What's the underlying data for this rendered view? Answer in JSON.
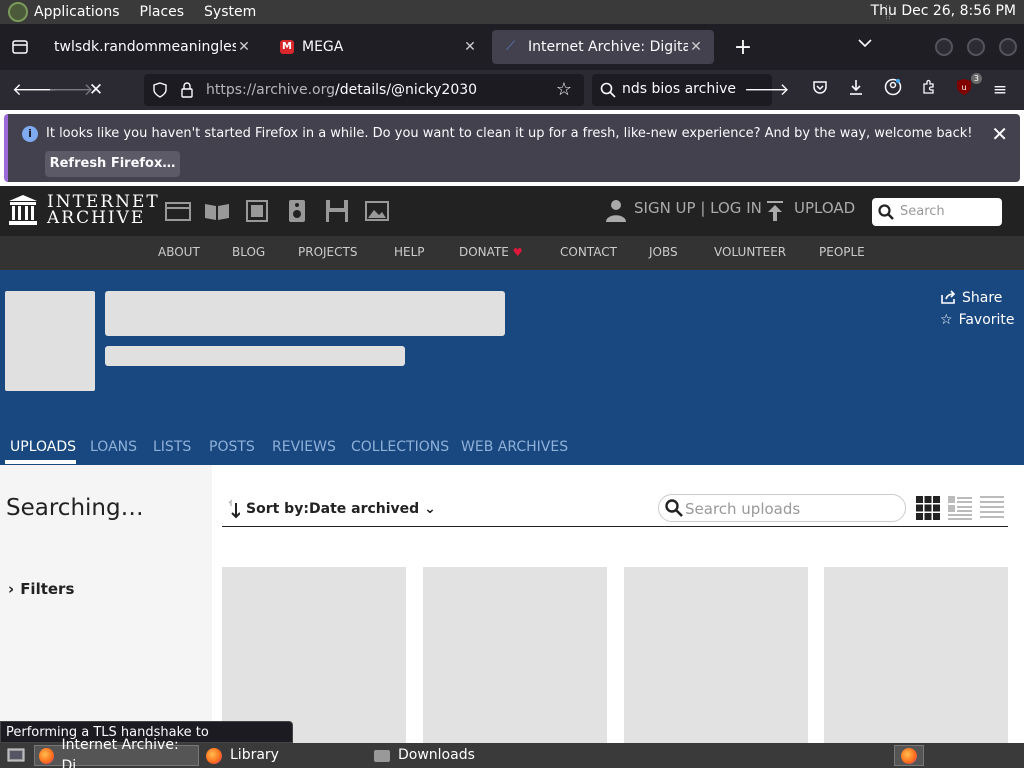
{
  "system_panel": {
    "menus": [
      "Applications",
      "Places",
      "System"
    ],
    "clock": "Thu Dec 26,  8:56 PM"
  },
  "tabs": [
    {
      "title": "twlsdk.randommeaninglesscha",
      "favicon": "document-icon"
    },
    {
      "title": "MEGA",
      "favicon": "mega-icon",
      "favicon_letter": "M"
    },
    {
      "title": "Internet Archive: Digital Libr",
      "favicon": "internet-archive-icon",
      "active": true
    }
  ],
  "navbar": {
    "url_host": "https://archive.org",
    "url_path": "/details/@nicky2030",
    "search_query": "nds bios archive",
    "extension_badge": "3"
  },
  "notification": {
    "message": "It looks like you haven't started Firefox in a while. Do you want to clean it up for a fresh, like-new experience? And by the way, welcome back!",
    "button": "Refresh Firefox…"
  },
  "ia_header": {
    "logo_line1": "INTERNET",
    "logo_line2": "ARCHIVE",
    "signup": "SIGN UP | LOG IN",
    "upload": "UPLOAD",
    "search_placeholder": "Search"
  },
  "ia_subnav": [
    "ABOUT",
    "BLOG",
    "PROJECTS",
    "HELP",
    "DONATE",
    "CONTACT",
    "JOBS",
    "VOLUNTEER",
    "PEOPLE"
  ],
  "profile": {
    "share": "Share",
    "favorite": "Favorite",
    "tabs": [
      "UPLOADS",
      "LOANS",
      "LISTS",
      "POSTS",
      "REVIEWS",
      "COLLECTIONS",
      "WEB ARCHIVES"
    ]
  },
  "content": {
    "searching": "Searching…",
    "filters": "Filters",
    "sort_label": "Sort by:",
    "sort_value": "Date archived",
    "search_placeholder": "Search uploads"
  },
  "status_text": "Performing a TLS handshake to archive.org…",
  "taskbar": [
    {
      "label": "Internet Archive: Di…",
      "icon": "firefox-icon"
    },
    {
      "label": "Library",
      "icon": "firefox-icon"
    },
    {
      "label": "Downloads",
      "icon": "folder-icon"
    }
  ],
  "colors": {
    "ia_blue": "#194880",
    "firefox_dark": "#1c1b22",
    "notify_accent": "#9a6ad8"
  }
}
